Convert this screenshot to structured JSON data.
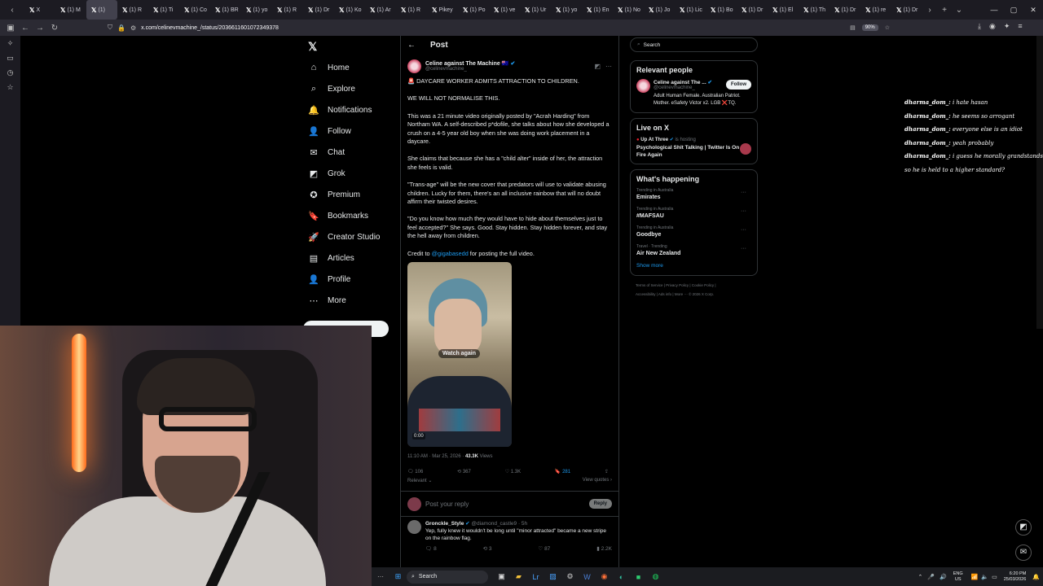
{
  "browser": {
    "tabs": [
      {
        "label": "X"
      },
      {
        "label": "(1) M"
      },
      {
        "label": "(1)"
      },
      {
        "label": "(1) R"
      },
      {
        "label": "(1) Ti"
      },
      {
        "label": "(1) Co"
      },
      {
        "label": "(1) BR"
      },
      {
        "label": "(1) yo"
      },
      {
        "label": "(1) R"
      },
      {
        "label": "(1) Dr"
      },
      {
        "label": "(1) Ko"
      },
      {
        "label": "(1) Ar"
      },
      {
        "label": "(1) R"
      },
      {
        "label": "Pikey"
      },
      {
        "label": "(1) Po"
      },
      {
        "label": "(1) ve"
      },
      {
        "label": "(1) Ur"
      },
      {
        "label": "(1) yo"
      },
      {
        "label": "(1) En"
      },
      {
        "label": "(1) No"
      },
      {
        "label": "(1) Jo"
      },
      {
        "label": "(1) Lic"
      },
      {
        "label": "(1) Bo"
      },
      {
        "label": "(1) Dr"
      },
      {
        "label": "(1) El"
      },
      {
        "label": "(1) Th"
      },
      {
        "label": "(1) Dr"
      },
      {
        "label": "(1) re"
      },
      {
        "label": "(1) Dr"
      }
    ],
    "url": "x.com/celinevmachine_/status/2036611601072349378",
    "zoom": "90%"
  },
  "xnav": {
    "logo": "𝕏",
    "items": [
      {
        "label": "Home",
        "icon": "home-icon",
        "glyph": "⌂"
      },
      {
        "label": "Explore",
        "icon": "search-icon",
        "glyph": "⌕"
      },
      {
        "label": "Notifications",
        "icon": "bell-icon",
        "glyph": "🔔"
      },
      {
        "label": "Follow",
        "icon": "person-add-icon",
        "glyph": "👤"
      },
      {
        "label": "Chat",
        "icon": "envelope-icon",
        "glyph": "✉"
      },
      {
        "label": "Grok",
        "icon": "grok-icon",
        "glyph": "◩"
      },
      {
        "label": "Premium",
        "icon": "verified-icon",
        "glyph": "✪"
      },
      {
        "label": "Bookmarks",
        "icon": "bookmark-icon",
        "glyph": "🔖"
      },
      {
        "label": "Creator Studio",
        "icon": "rocket-icon",
        "glyph": "🚀"
      },
      {
        "label": "Articles",
        "icon": "document-icon",
        "glyph": "▤"
      },
      {
        "label": "Profile",
        "icon": "person-icon",
        "glyph": "👤"
      },
      {
        "label": "More",
        "icon": "more-icon",
        "glyph": "⋯"
      }
    ],
    "post_button": "Post"
  },
  "post": {
    "header_title": "Post",
    "author_name": "Celine against The Machine",
    "author_flag": "🇦🇺",
    "author_handle": "@celinevmachine_",
    "para1": "🚨 DAYCARE WORKER ADMITS ATTRACTION TO CHILDREN.",
    "para2": "WE WILL NOT NORMALISE THIS.",
    "para3": "This was a 21 minute video originally posted by \"Acrah Harding\" from Northam WA. A self-described p*dofile, she talks about how she developed a crush on a 4-5 year old boy when she was doing work placement in a daycare.",
    "para4": "She claims that because she has a \"child alter\" inside of her, the attraction she feels is valid.",
    "para5": "\"Trans-age\" will be the new cover that predators will use to validate abusing children. Lucky for them, there's an all inclusive rainbow that will no doubt affirm their twisted desires.",
    "para6": "\"Do you know how much they would have to hide about themselves just to feel accepted?\" She says. Good. Stay hidden. Stay hidden forever, and stay the hell away from children.",
    "credit_prefix": "Credit to ",
    "credit_handle": "@gigabasedd",
    "credit_suffix": " for posting the full video.",
    "video_watch_again": "Watch again",
    "video_time": "0:00",
    "meta_time": "11:10 AM · Mar 25, 2026 · ",
    "meta_views_count": "43.3K",
    "meta_views_label": " Views",
    "stats": {
      "replies": "106",
      "reposts": "367",
      "likes": "1.3K",
      "bookmarks": "281"
    },
    "sort_label": "Relevant ⌄",
    "view_quotes": "View quotes ›",
    "reply_placeholder": "Post your reply",
    "reply_button": "Reply"
  },
  "reply_post": {
    "author_name": "Gronckle_Style",
    "author_handle": "@diamond_castle9 · 5h",
    "text": "Yep, fully knew it wouldn't be long until \"minor attracted\" became a new stripe on the rainbow flag.",
    "stats": {
      "replies": "8",
      "reposts": "3",
      "likes": "87",
      "views": "2.2K"
    }
  },
  "right": {
    "search_placeholder": "Search",
    "relevant_title": "Relevant people",
    "person_name": "Celine against The ...",
    "person_handle": "@celinevmachine_",
    "follow_button": "Follow",
    "person_bio": "Adult Human Female. Australian Patriot. Mother. eSafety Victor x2. LGB ❌TQ.",
    "live_title": "Live on X",
    "live_host": "Up At Three",
    "live_is_hosting": " is hosting",
    "live_show": "Psychological Shit Talking | Twitter Is On Fire Again",
    "happening_title": "What's happening",
    "trends": [
      {
        "context": "Trending in Australia",
        "title": "Emirates"
      },
      {
        "context": "Trending in Australia",
        "title": "#MAFSAU"
      },
      {
        "context": "Trending in Australia",
        "title": "Goodbye"
      },
      {
        "context": "Travel · Trending",
        "title": "Air New Zealand"
      }
    ],
    "show_more": "Show more",
    "footer1": "Terms of Service   |   Privacy Policy   |   Cookie Policy   |",
    "footer2": "Accessibility   |   Ads info   |   More ···   © 2026 X Corp."
  },
  "chat": [
    {
      "user": "dharma_dom_:",
      "msg": " i hate hasan"
    },
    {
      "user": "dharma_dom_:",
      "msg": " he seems so arrogant"
    },
    {
      "user": "dharma_dom_:",
      "msg": " everyone else is an idiot"
    },
    {
      "user": "dharma_dom_:",
      "msg": " yeah probably"
    },
    {
      "user": "dharma_dom_:",
      "msg": " i guess he morally grandstands?"
    },
    {
      "user": "",
      "msg": "so he is held to a higher standard?"
    }
  ],
  "taskbar": {
    "search_label": "Search",
    "lang": "ENG",
    "region": "US",
    "time": "6:20 PM",
    "date": "25/03/2026"
  },
  "colors": {
    "accent": "#1d9bf0",
    "bg": "#000000",
    "border": "#2f3336"
  }
}
